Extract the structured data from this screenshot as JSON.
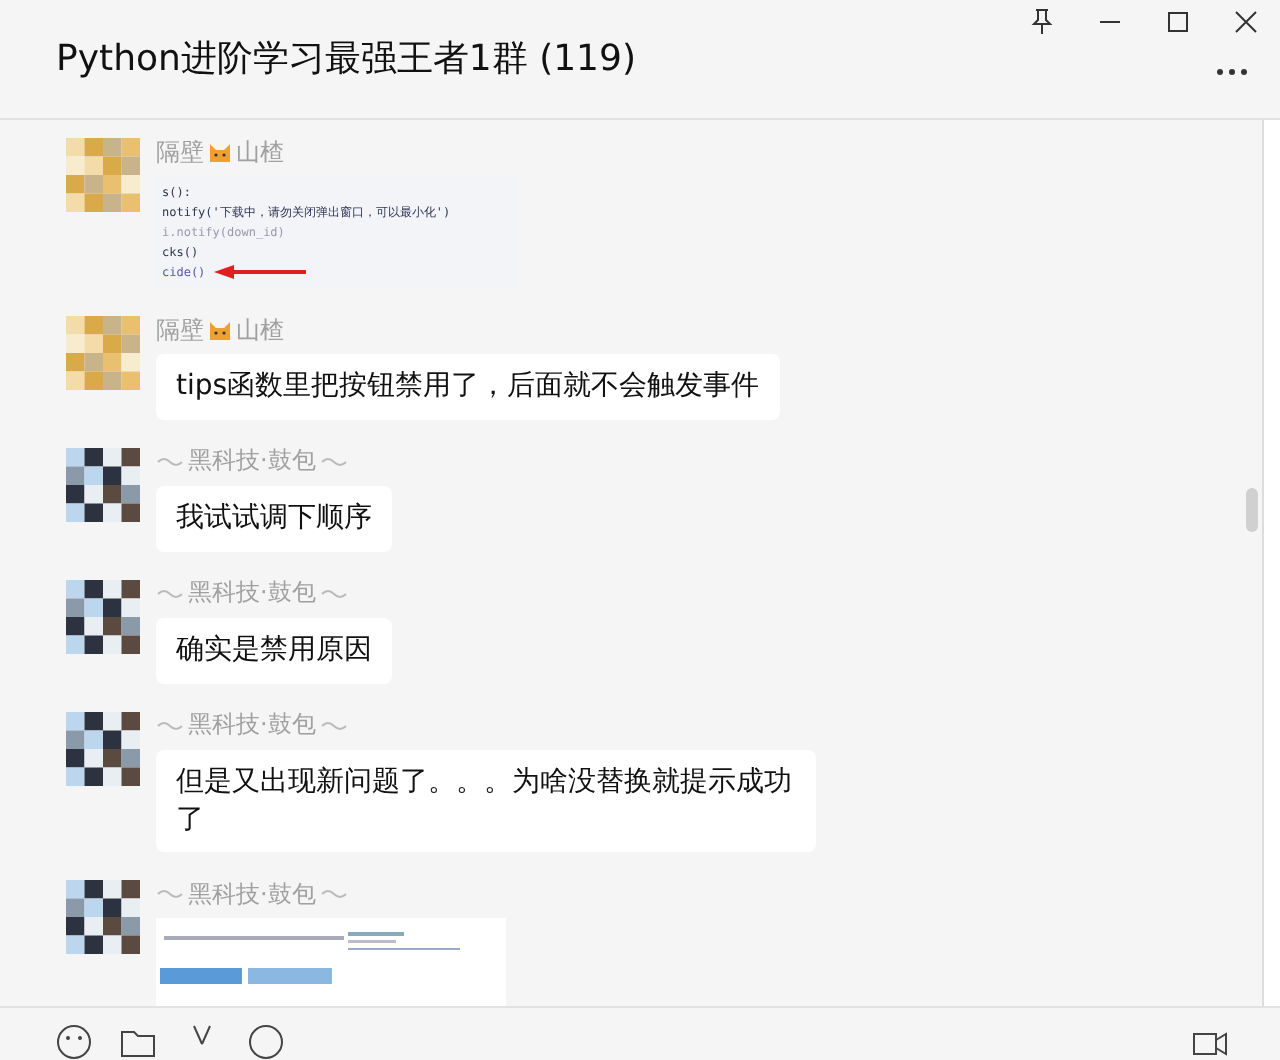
{
  "window": {
    "title": "Python进阶学习最强王者1群 (119)"
  },
  "messages": [
    {
      "sender": {
        "kind": "cat",
        "parts": [
          "隔壁",
          "山楂"
        ]
      },
      "kind": "code",
      "lines": [
        "s():",
        "notify('下载中，请勿关闭弹出窗口，可以最小化')",
        "i.notify(down_id)",
        "cks()",
        "cide()"
      ]
    },
    {
      "sender": {
        "kind": "cat",
        "parts": [
          "隔壁",
          "山楂"
        ]
      },
      "kind": "text",
      "text": "tips函数里把按钮禁用了，后面就不会触发事件"
    },
    {
      "sender": {
        "kind": "ornate",
        "parts": [
          "黑科技·鼓包"
        ]
      },
      "kind": "text",
      "text": "我试试调下顺序"
    },
    {
      "sender": {
        "kind": "ornate",
        "parts": [
          "黑科技·鼓包"
        ]
      },
      "kind": "text",
      "text": "确实是禁用原因"
    },
    {
      "sender": {
        "kind": "ornate",
        "parts": [
          "黑科技·鼓包"
        ]
      },
      "kind": "text",
      "text": "但是又出现新问题了。。。为啥没替换就提示成功了"
    },
    {
      "sender": {
        "kind": "ornate",
        "parts": [
          "黑科技·鼓包"
        ]
      },
      "kind": "picture"
    }
  ]
}
